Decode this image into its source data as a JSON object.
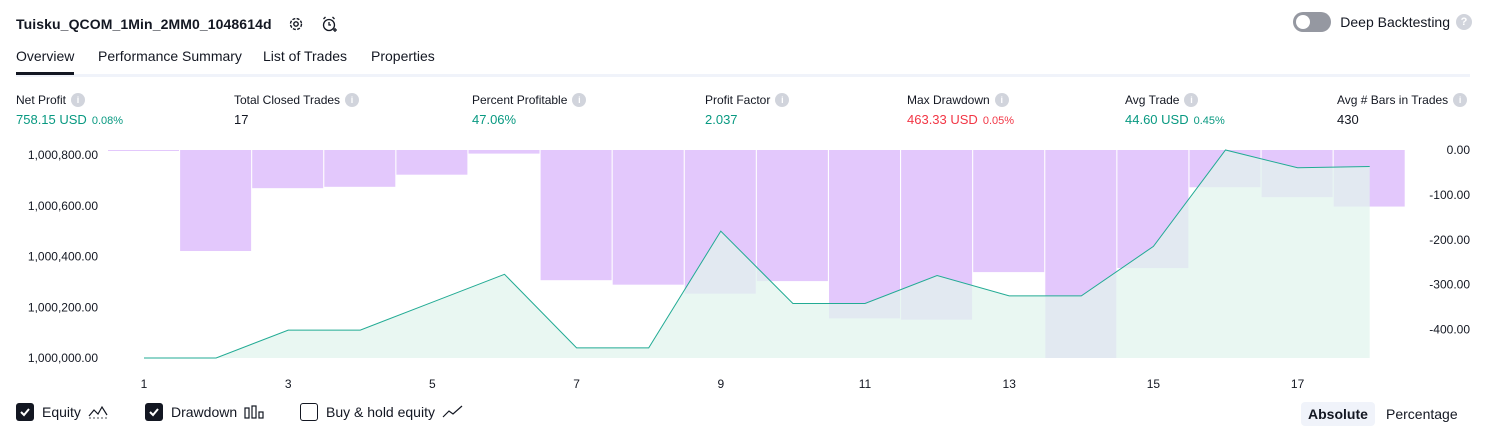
{
  "header": {
    "strategy_name": "Tuisku_QCOM_1Min_2MM0_1048614d",
    "settings_icon": "gear-icon",
    "alert_icon": "alarm-clock-plus-icon"
  },
  "deep_backtesting": {
    "label": "Deep Backtesting",
    "enabled": false
  },
  "tabs": [
    {
      "label": "Overview",
      "active": true
    },
    {
      "label": "Performance Summary",
      "active": false
    },
    {
      "label": "List of Trades",
      "active": false
    },
    {
      "label": "Properties",
      "active": false
    }
  ],
  "metrics": {
    "net_profit": {
      "label": "Net Profit",
      "value": "758.15 USD",
      "percent": "0.08%"
    },
    "total_closed_trades": {
      "label": "Total Closed Trades",
      "value": "17"
    },
    "percent_profitable": {
      "label": "Percent Profitable",
      "value": "47.06%"
    },
    "profit_factor": {
      "label": "Profit Factor",
      "value": "2.037"
    },
    "max_drawdown": {
      "label": "Max Drawdown",
      "value": "463.33 USD",
      "percent": "0.05%"
    },
    "avg_trade": {
      "label": "Avg Trade",
      "value": "44.60 USD",
      "percent": "0.45%"
    },
    "avg_bars": {
      "label": "Avg # Bars in Trades",
      "value": "430"
    }
  },
  "colors": {
    "equity_line": "#22ab94",
    "equity_fill": "#e2f4ee",
    "drawdown_bar": "#e1c5fc",
    "positive": "#089981",
    "negative": "#f23645"
  },
  "chart_data": {
    "type": "line",
    "x_ticks": [
      "1",
      "3",
      "5",
      "7",
      "9",
      "11",
      "13",
      "15",
      "17"
    ],
    "left_ticks": [
      "1,000,800.00",
      "1,000,600.00",
      "1,000,400.00",
      "1,000,200.00",
      "1,000,000.00"
    ],
    "right_ticks": [
      "0.00",
      "-100.00",
      "-200.00",
      "-300.00",
      "-400.00"
    ],
    "left_ylim": [
      1000000,
      1000820
    ],
    "right_ylim": [
      -463.33,
      0
    ],
    "series": [
      {
        "name": "Equity",
        "type": "area",
        "x": [
          1,
          2,
          3,
          4,
          5,
          6,
          7,
          8,
          9,
          10,
          11,
          12,
          13,
          14,
          15,
          16,
          17,
          18
        ],
        "values": [
          1000000,
          1000000,
          1000110,
          1000110,
          1000220,
          1000330,
          1000040,
          1000040,
          1000500,
          1000215,
          1000215,
          1000325,
          1000245,
          1000245,
          1000440,
          1000820,
          1000750,
          1000755
        ]
      },
      {
        "name": "Drawdown",
        "type": "bar",
        "x": [
          1,
          2,
          3,
          4,
          5,
          6,
          7,
          8,
          9,
          10,
          11,
          12,
          13,
          14,
          15,
          16,
          17,
          18
        ],
        "values": [
          -2,
          -225,
          -85,
          -82,
          -55,
          -8,
          -290,
          -300,
          -320,
          -292,
          -375,
          -378,
          -272,
          -463.33,
          -263,
          -83,
          -105,
          -126
        ]
      }
    ]
  },
  "legend": {
    "equity": {
      "label": "Equity",
      "checked": true
    },
    "drawdown": {
      "label": "Drawdown",
      "checked": true
    },
    "buy_hold": {
      "label": "Buy & hold equity",
      "checked": false
    }
  },
  "mode": {
    "absolute": "Absolute",
    "percentage": "Percentage",
    "selected": "Absolute"
  }
}
